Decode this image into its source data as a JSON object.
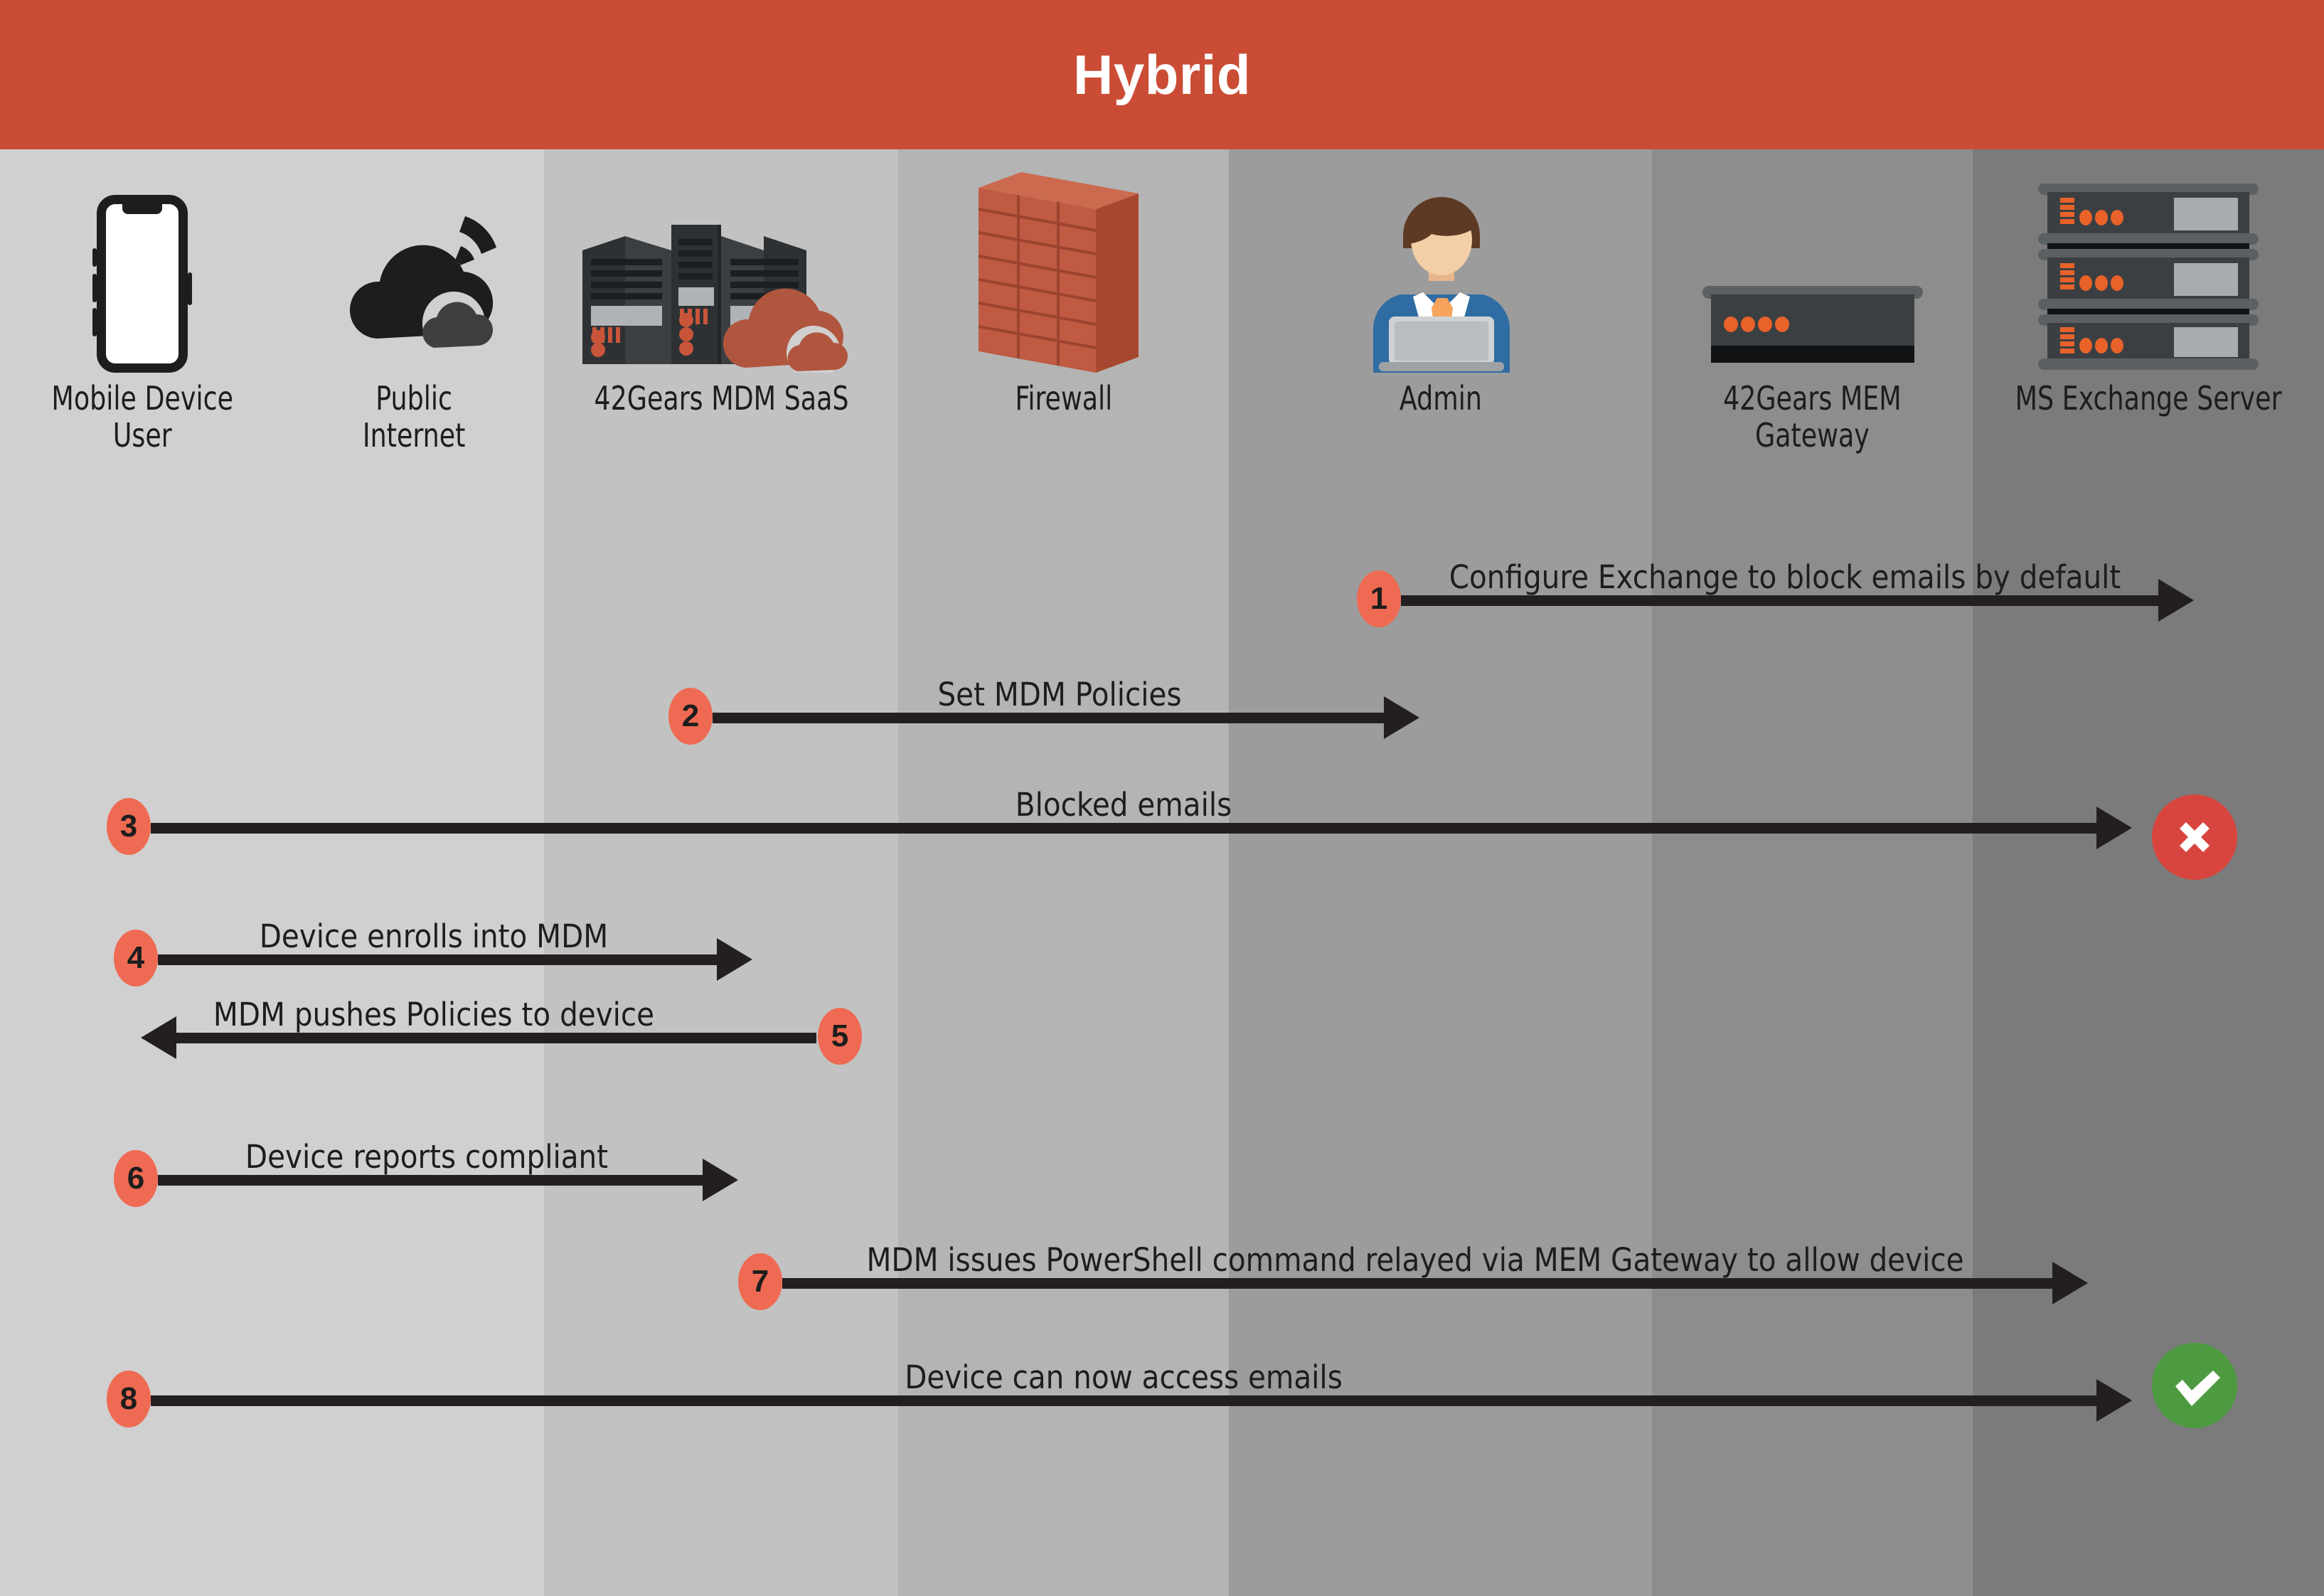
{
  "header": {
    "title": "Hybrid"
  },
  "theme": {
    "header_bg": "#cb4c35",
    "badge_bg": "#ef6a52",
    "arrow_color": "#231f20",
    "deny_color": "#d8453e",
    "allow_color": "#4e9a41",
    "lane_colors": [
      "#d0d0d0",
      "#c2c2c2",
      "#b4b4b4",
      "#9c9c9c",
      "#8d8d8d",
      "#7b7b7b"
    ]
  },
  "columns": [
    {
      "label": "Mobile Device\nUser",
      "icon": "mobile-phone-icon"
    },
    {
      "label": "Public\nInternet",
      "icon": "cloud-wifi-icon"
    },
    {
      "label": "42Gears MDM SaaS",
      "icon": "server-cloud-icon"
    },
    {
      "label": "Firewall",
      "icon": "brick-wall-icon"
    },
    {
      "label": "Admin",
      "icon": "admin-person-laptop-icon"
    },
    {
      "label": "42Gears MEM\nGateway",
      "icon": "gateway-appliance-icon"
    },
    {
      "label": "MS Exchange Server",
      "icon": "server-rack-icon"
    }
  ],
  "steps": [
    {
      "number": "1",
      "label": "Configure Exchange to block emails by default",
      "direction": "right",
      "end_marker": "none"
    },
    {
      "number": "2",
      "label": "Set MDM Policies",
      "direction": "right",
      "end_marker": "none"
    },
    {
      "number": "3",
      "label": "Blocked emails",
      "direction": "right",
      "end_marker": "deny"
    },
    {
      "number": "4",
      "label": "Device enrolls into MDM",
      "direction": "right",
      "end_marker": "none"
    },
    {
      "number": "5",
      "label": "MDM pushes Policies to device",
      "direction": "left",
      "end_marker": "none"
    },
    {
      "number": "6",
      "label": "Device reports compliant",
      "direction": "right",
      "end_marker": "none"
    },
    {
      "number": "7",
      "label": "MDM issues PowerShell command relayed via MEM Gateway to allow device",
      "direction": "right",
      "end_marker": "none"
    },
    {
      "number": "8",
      "label": "Device can now access emails",
      "direction": "right",
      "end_marker": "allow"
    }
  ],
  "markers": {
    "deny_glyph": "✕",
    "allow_glyph": "✓"
  }
}
